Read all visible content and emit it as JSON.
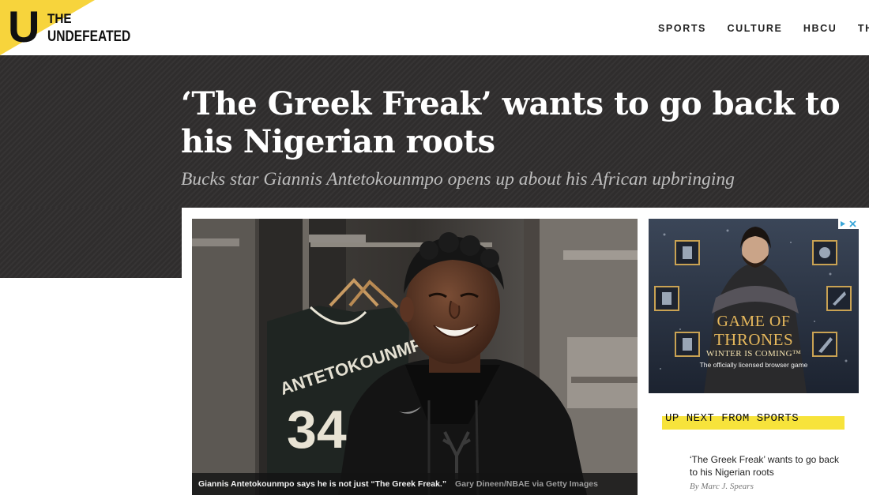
{
  "site": {
    "logo_letter": "U",
    "logo_line1": "THE",
    "logo_line2": "UNDEFEATED"
  },
  "nav": {
    "items": [
      "SPORTS",
      "CULTURE",
      "HBCU",
      "THE U"
    ]
  },
  "article": {
    "headline": "‘The Greek Freak’ wants to go back to his Nigerian roots",
    "subhead": "Bucks star Giannis Antetokounmpo opens up about his African upbringing",
    "photo": {
      "jersey_name": "ANTETOKOUNMPO",
      "jersey_number": "34",
      "caption": "Giannis Antetokounmpo says he is not just “The Greek Freak.”",
      "credit": "Gary Dineen/NBAE via Getty Images"
    }
  },
  "ad": {
    "title_line1": "GAME OF",
    "title_line2": "THRONES",
    "tagline": "WINTER IS COMING™",
    "subtitle": "The officially licensed browser game",
    "adchoices_icon": "adchoices-icon",
    "close_icon": "close-icon"
  },
  "up_next": {
    "label": "UP NEXT FROM SPORTS",
    "story_title": "‘The Greek Freak’ wants to go back to his Nigerian roots",
    "byline": "By Marc J. Spears"
  },
  "colors": {
    "brand_yellow": "#f7d43c",
    "hero_dark": "#2f2d2d",
    "highlight_yellow": "#f7e33b"
  }
}
